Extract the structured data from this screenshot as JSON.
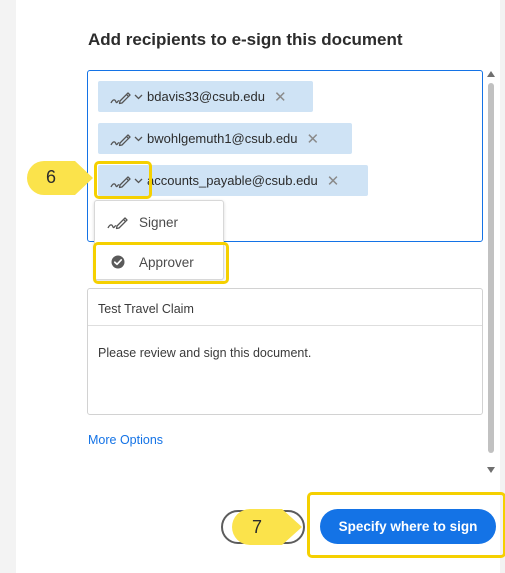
{
  "dialog": {
    "title": "Add recipients to e-sign this document"
  },
  "recipients": [
    {
      "email": "bdavis33@csub.edu",
      "role_icon": "signer-pen-icon"
    },
    {
      "email": "bwohlgemuth1@csub.edu",
      "role_icon": "signer-pen-icon"
    },
    {
      "email": "accounts_payable@csub.edu",
      "role_icon": "signer-pen-icon"
    }
  ],
  "role_menu": {
    "items": [
      {
        "label": "Signer",
        "icon": "signer-pen-icon"
      },
      {
        "label": "Approver",
        "icon": "checkmark-circle-icon"
      }
    ]
  },
  "message": {
    "subject": "Test Travel Claim",
    "body": "Please review and sign this document."
  },
  "links": {
    "more_options": "More Options"
  },
  "actions": {
    "primary_label": "Specify where to sign"
  },
  "callouts": [
    {
      "number": "6"
    },
    {
      "number": "7"
    }
  ],
  "colors": {
    "accent": "#1473e6",
    "chip_bg": "#cfe3f5",
    "highlight": "#f5d000",
    "callout": "#fbe34b"
  }
}
